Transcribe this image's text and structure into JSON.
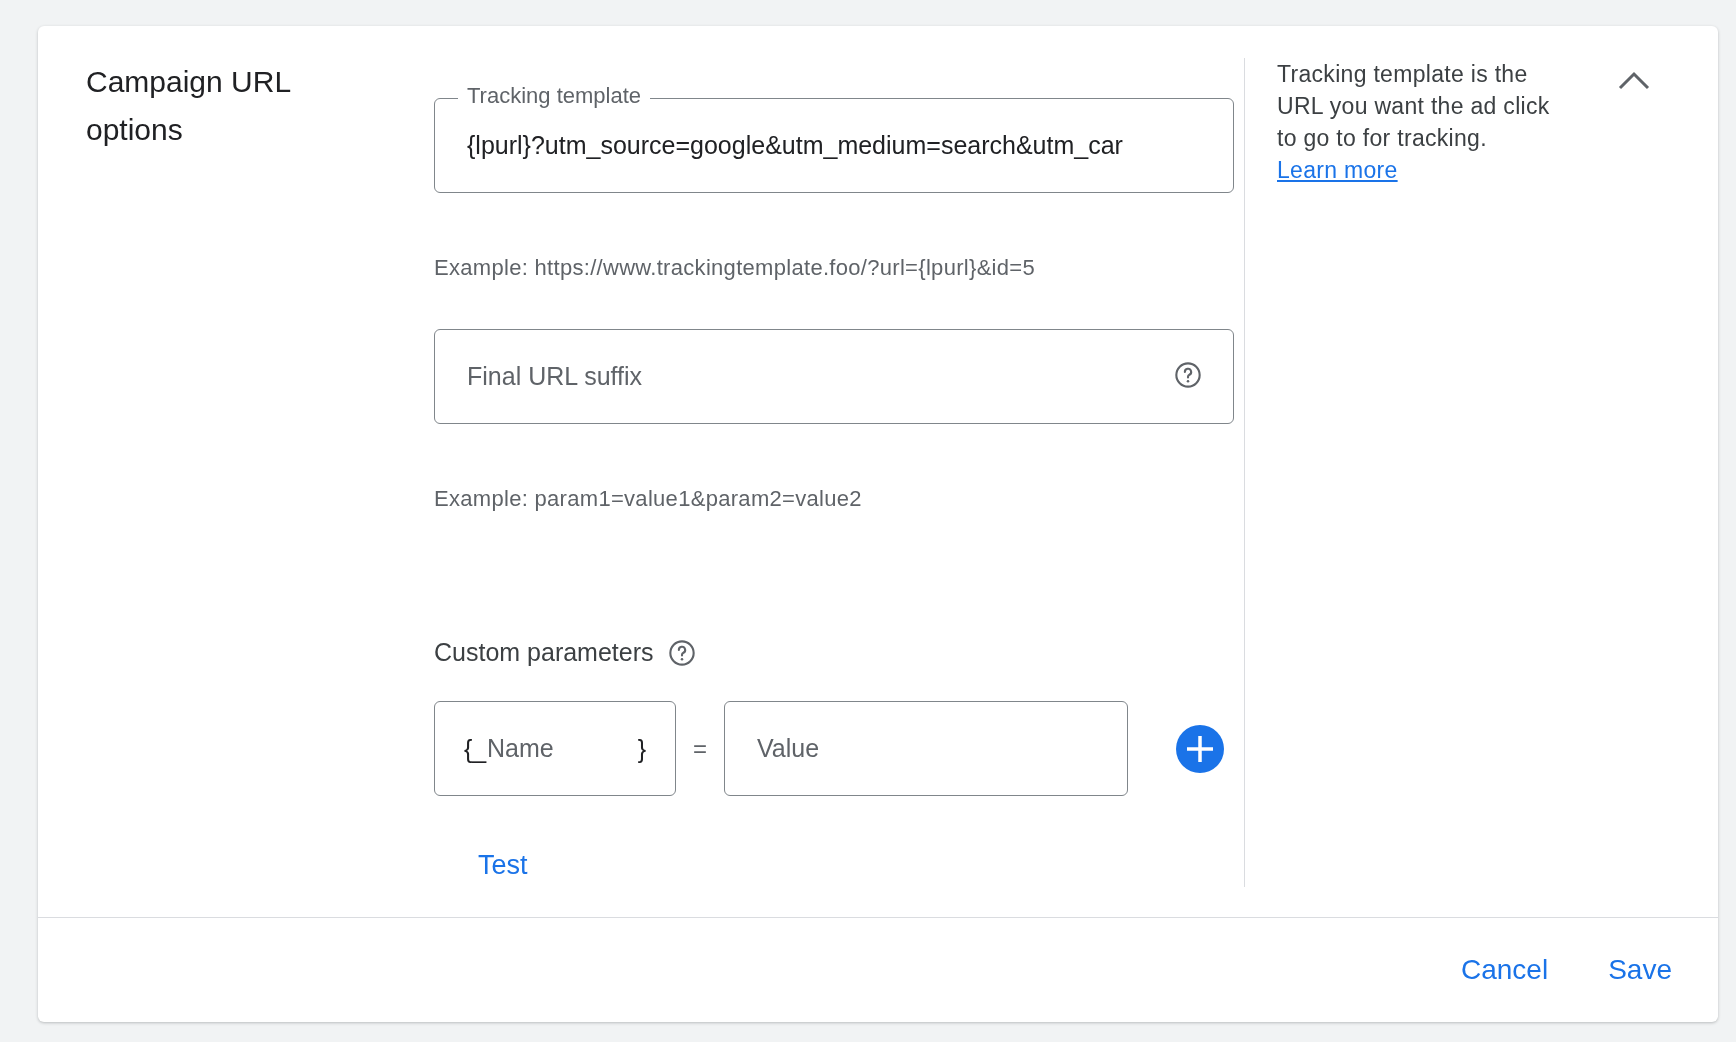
{
  "section": {
    "title": "Campaign URL options",
    "expanded": true
  },
  "tracking_template": {
    "label": "Tracking template",
    "value": "{lpurl}?utm_source=google&utm_medium=search&utm_car",
    "example": "Example: https://www.trackingtemplate.foo/?url={lpurl}&id=5"
  },
  "final_url_suffix": {
    "placeholder": "Final URL suffix",
    "example": "Example: param1=value1&param2=value2"
  },
  "custom_parameters": {
    "label": "Custom parameters",
    "name_prefix": "{_",
    "name_placeholder": "Name",
    "name_suffix": "}",
    "equals": "=",
    "value_placeholder": "Value"
  },
  "test_button": "Test",
  "help": {
    "text": "Tracking template is the URL you want the ad click to go to for tracking.",
    "link": "Learn more"
  },
  "buttons": [
    "Cancel",
    "Save"
  ]
}
